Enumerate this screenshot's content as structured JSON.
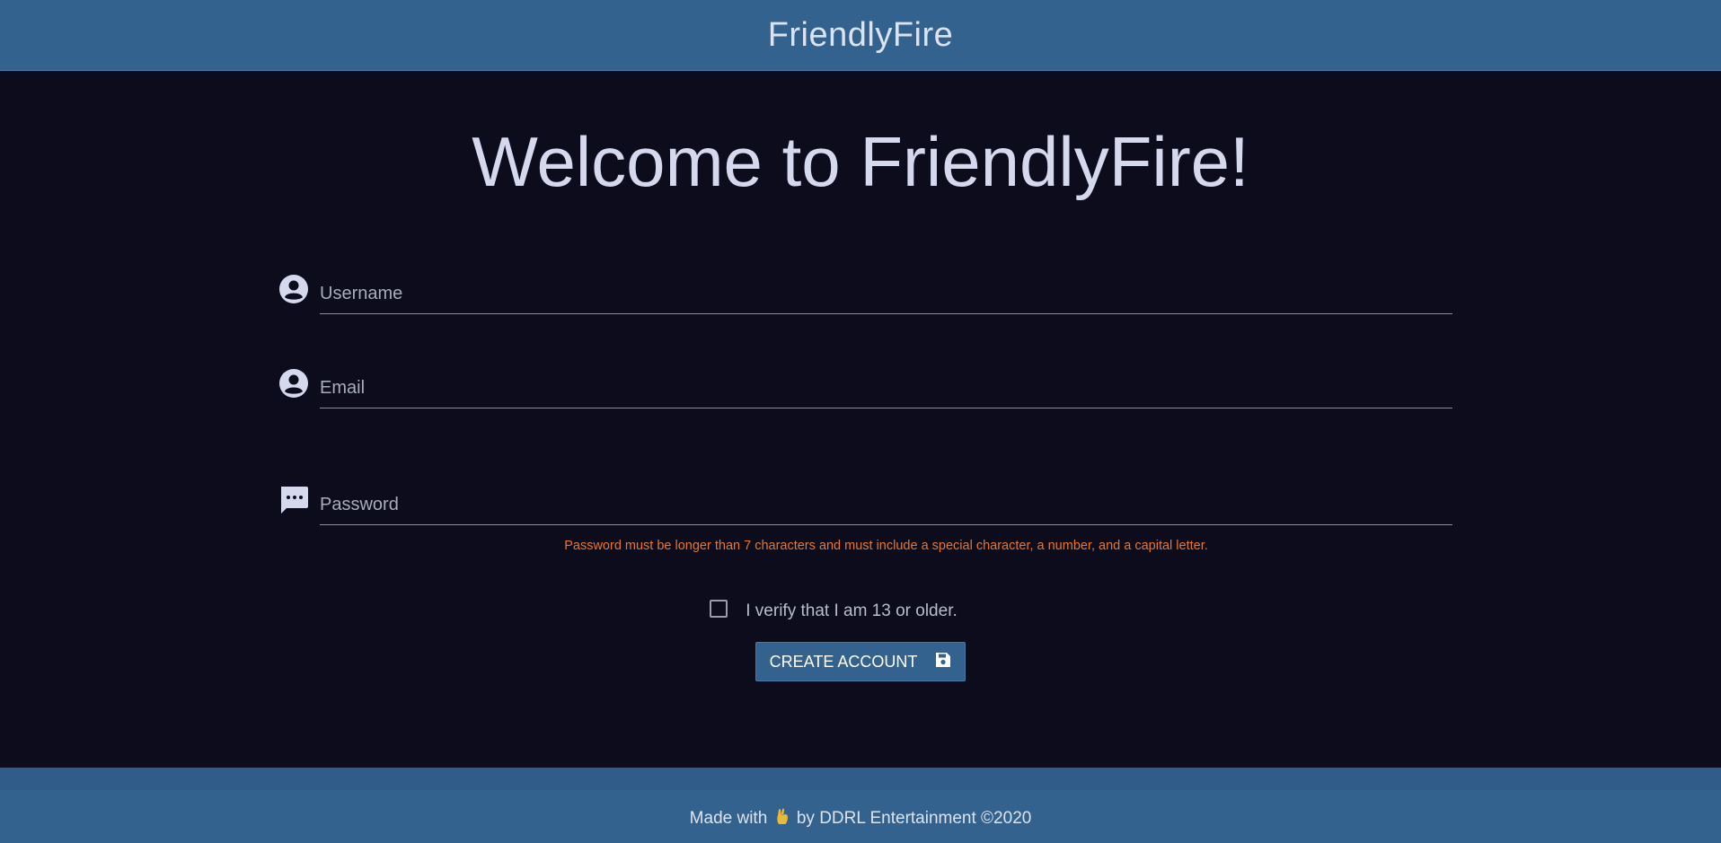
{
  "header": {
    "title": "FriendlyFire"
  },
  "main": {
    "heading": "Welcome to FriendlyFire!",
    "fields": {
      "username": {
        "placeholder": "Username",
        "value": "",
        "icon": "account-circle-icon"
      },
      "email": {
        "placeholder": "Email",
        "value": "",
        "icon": "account-circle-icon"
      },
      "password": {
        "placeholder": "Password",
        "value": "",
        "icon": "message-dots-icon"
      }
    },
    "password_hint": "Password must be longer than 7 characters and must include a special character, a number, and a capital letter.",
    "verify_label": "I verify that I am 13 or older.",
    "verify_checked": false,
    "create_button": {
      "label": "CREATE ACCOUNT",
      "icon": "floppy-save-icon"
    }
  },
  "footer": {
    "made_with": "Made with",
    "by_text": "by DDRL Entertainment ©2020",
    "icon": "crossed-fingers-icon"
  },
  "colors": {
    "bar": "#33628f",
    "background": "#0c0c1c",
    "hint": "#e7762a"
  }
}
